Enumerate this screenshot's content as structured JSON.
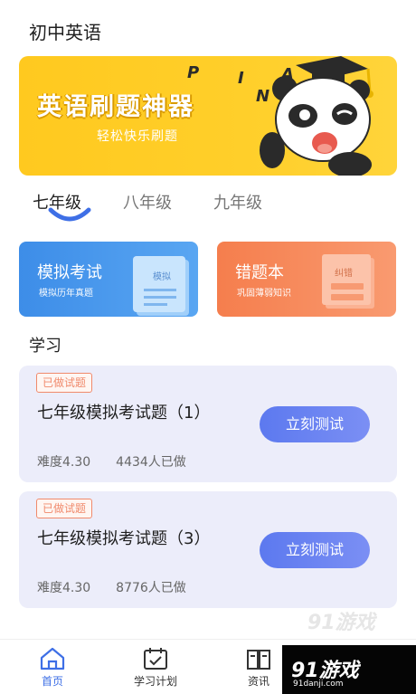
{
  "header": {
    "title": "初中英语"
  },
  "banner": {
    "title": "英语刷题神器",
    "subtitle": "轻松快乐刷题",
    "letters": [
      "P",
      "I",
      "A",
      "N"
    ]
  },
  "grades": {
    "tabs": [
      {
        "label": "七年级",
        "active": true
      },
      {
        "label": "八年级",
        "active": false
      },
      {
        "label": "九年级",
        "active": false
      }
    ]
  },
  "features": {
    "mock": {
      "title": "模拟考试",
      "subtitle": "模拟历年真题",
      "doc_label": "模拟"
    },
    "wrong": {
      "title": "错题本",
      "subtitle": "巩固薄弱知识",
      "doc_label": "纠错"
    }
  },
  "study": {
    "section_title": "学习",
    "items": [
      {
        "badge": "已做试题",
        "title": "七年级模拟考试题（1）",
        "difficulty": "难度4.30",
        "count": "4434人已做",
        "button": "立刻测试"
      },
      {
        "badge": "已做试题",
        "title": "七年级模拟考试题（3）",
        "difficulty": "难度4.30",
        "count": "8776人已做",
        "button": "立刻测试"
      }
    ]
  },
  "nav": {
    "items": [
      {
        "label": "首页",
        "icon": "home-icon",
        "active": true
      },
      {
        "label": "学习计划",
        "icon": "calendar-check-icon",
        "active": false
      },
      {
        "label": "资讯",
        "icon": "book-icon",
        "active": false
      }
    ]
  },
  "watermark": {
    "logo": "91游戏",
    "url": "91danji.com",
    "float_logo": "91游戏"
  },
  "colors": {
    "banner": "#ffc91f",
    "mock_card": "#3d8de8",
    "wrong_card": "#f57e4d",
    "button": "#5c79ef",
    "active_nav": "#3e6fe6",
    "badge": "#f08a6c"
  }
}
